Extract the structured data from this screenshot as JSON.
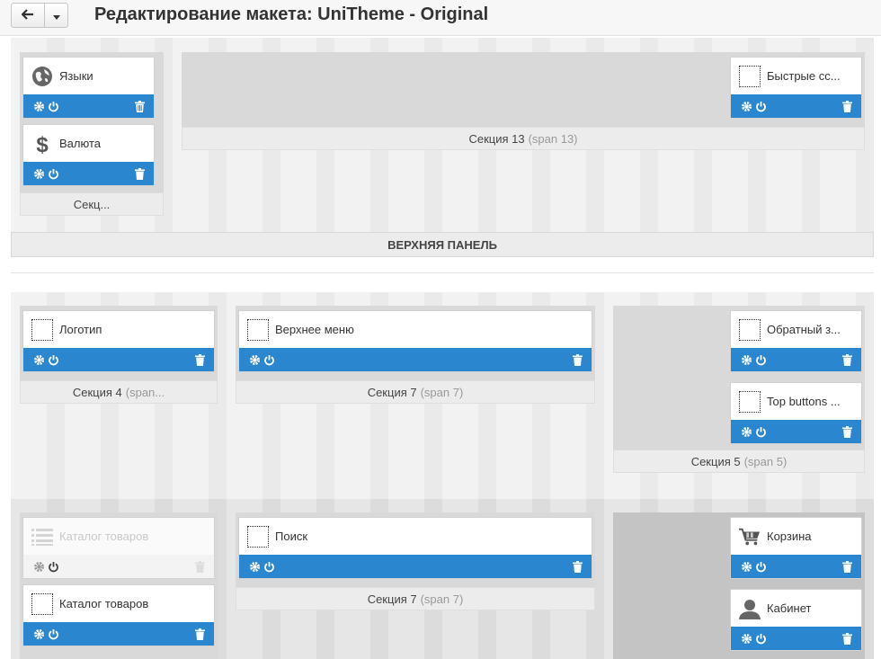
{
  "header": {
    "title": "Редактирование макета: UniTheme - Original",
    "back_icon": "arrow-left-icon",
    "dropdown_icon": "caret-down-icon"
  },
  "colors": {
    "block_bar": "#2b86d0",
    "section_label_bg": "#ececed"
  },
  "top_panel": {
    "label": "ВЕРХНЯЯ ПАНЕЛЬ",
    "sections": [
      {
        "name": "Секц...",
        "span": "",
        "blocks": [
          {
            "title": "Языки",
            "icon": "globe-icon"
          },
          {
            "title": "Валюта",
            "icon": "dollar-icon"
          }
        ]
      },
      {
        "name": "Секция 13",
        "span": "(span 13)",
        "blocks": [
          {
            "title": "Быстрые сс...",
            "icon": "placeholder-icon"
          }
        ]
      }
    ]
  },
  "header_row1": {
    "sections": [
      {
        "name": "Секция 4",
        "span": "(span...",
        "blocks": [
          {
            "title": "Логотип",
            "icon": "placeholder-icon"
          }
        ]
      },
      {
        "name": "Секция 7",
        "span": "(span 7)",
        "blocks": [
          {
            "title": "Верхнее меню",
            "icon": "placeholder-icon"
          }
        ]
      },
      {
        "name": "Секция 5",
        "span": "(span 5)",
        "blocks": [
          {
            "title": "Обратный з...",
            "icon": "placeholder-icon"
          },
          {
            "title": "Top buttons ...",
            "icon": "placeholder-icon"
          }
        ]
      }
    ]
  },
  "header_row2": {
    "sections": [
      {
        "name": "",
        "span": "",
        "blocks": [
          {
            "title": "Каталог товаров",
            "icon": "list-icon",
            "disabled": true
          },
          {
            "title": "Каталог товаров",
            "icon": "placeholder-icon"
          }
        ]
      },
      {
        "name": "Секция 7",
        "span": "(span 7)",
        "blocks": [
          {
            "title": "Поиск",
            "icon": "placeholder-icon"
          }
        ]
      },
      {
        "name": "",
        "span": "",
        "blocks": [
          {
            "title": "Корзина",
            "icon": "cart-icon"
          },
          {
            "title": "Кабинет",
            "icon": "user-icon"
          }
        ]
      }
    ]
  }
}
